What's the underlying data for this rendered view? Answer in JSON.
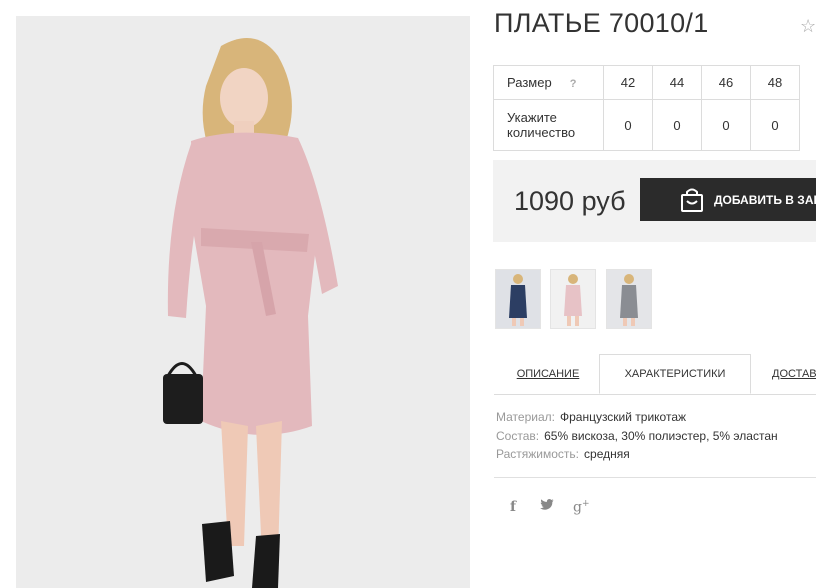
{
  "product": {
    "title": "ПЛАТЬЕ 70010/1",
    "favorite_icon": "star-outline-icon"
  },
  "size_table": {
    "size_label": "Размер",
    "help_mark": "?",
    "sizes": [
      "42",
      "44",
      "46",
      "48"
    ],
    "quantity_label": "Укажите количество",
    "quantities": [
      "0",
      "0",
      "0",
      "0"
    ]
  },
  "price": {
    "amount": "1090 руб",
    "buy_label": "ДОБАВИТЬ В ЗАКАЗ",
    "buy_icon": "shopping-bag-icon"
  },
  "thumbnails": [
    {
      "name": "thumb-navy-dress",
      "color": "#2c3e63"
    },
    {
      "name": "thumb-pink-dress",
      "color": "#e7c2c6"
    },
    {
      "name": "thumb-grey-dress",
      "color": "#8a8d93"
    }
  ],
  "tabs": [
    {
      "label": "ОПИСАНИЕ",
      "active": false
    },
    {
      "label": "ХАРАКТЕРИСТИКИ",
      "active": true
    },
    {
      "label": "ДОСТАВКА",
      "active": false
    }
  ],
  "specs": [
    {
      "key": "Материал:",
      "value": "Французский трикотаж"
    },
    {
      "key": "Состав:",
      "value": "65% вискоза, 30% полиэстер, 5% эластан"
    },
    {
      "key": "Растяжимость:",
      "value": "средняя"
    }
  ],
  "social": [
    {
      "name": "facebook-icon",
      "glyph": "f"
    },
    {
      "name": "twitter-icon",
      "glyph": "✦"
    },
    {
      "name": "google-plus-icon",
      "glyph": "g+"
    }
  ],
  "colors": {
    "dress_pink": "#e3b9bd",
    "button_dark": "#2b2b2b",
    "price_bg": "#f2f2f2"
  }
}
